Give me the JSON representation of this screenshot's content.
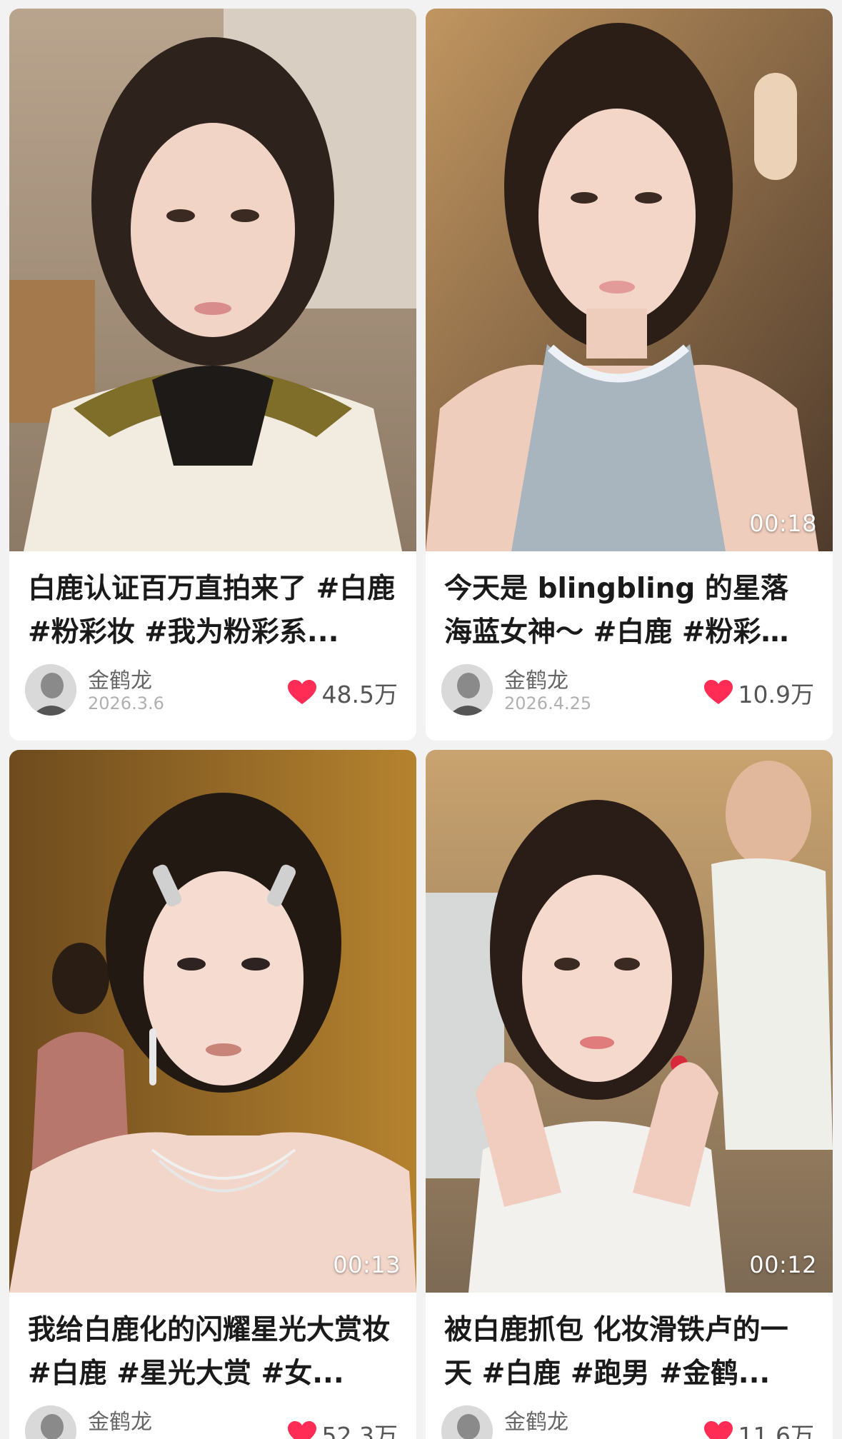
{
  "accent_color": "#ff2d55",
  "cards": [
    {
      "title": "白鹿认证百万直拍来了 #白鹿 #粉彩妆 #我为粉彩系...",
      "author": "金鹤龙",
      "date": "2026.3.6",
      "likes": "48.5万",
      "duration": ""
    },
    {
      "title": "今天是 blingbling 的星落海蓝女神～ #白鹿 #粉彩妆 #...",
      "author": "金鹤龙",
      "date": "2026.4.25",
      "likes": "10.9万",
      "duration": "00:18"
    },
    {
      "title": "我给白鹿化的闪耀星光大赏妆 #白鹿 #星光大赏 #女...",
      "author": "金鹤龙",
      "date": "",
      "likes": "52.3万",
      "duration": "00:13"
    },
    {
      "title": "被白鹿抓包 化妆滑铁卢的一天 #白鹿 #跑男 #金鹤...",
      "author": "金鹤龙",
      "date": "",
      "likes": "11.6万",
      "duration": "00:12"
    }
  ],
  "icons": {
    "like": "heart-icon",
    "avatar": "avatar"
  }
}
